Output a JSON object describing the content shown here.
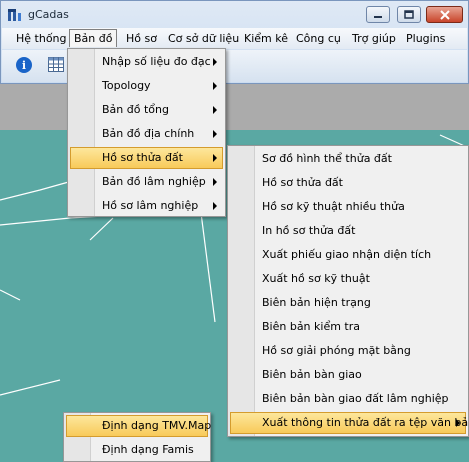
{
  "window": {
    "title": "gCadas"
  },
  "menubar": {
    "items": [
      "Hệ thống",
      "Bản đồ",
      "Hồ sơ",
      "Cơ sở dữ liệu",
      "Kiểm kê",
      "Công cụ",
      "Trợ giúp",
      "Plugins"
    ],
    "active": "Bản đồ"
  },
  "toolbar": {
    "info_icon": "i"
  },
  "menu_bando": {
    "items": [
      {
        "label": "Nhập số liệu đo đạc",
        "submenu": true
      },
      {
        "label": "Topology",
        "submenu": true
      },
      {
        "label": "Bản đồ tổng",
        "submenu": true
      },
      {
        "label": "Bản đồ địa chính",
        "submenu": true
      },
      {
        "label": "Hồ sơ thửa đất",
        "submenu": true,
        "highlighted": true
      },
      {
        "label": "Bản đồ lâm nghiệp",
        "submenu": true
      },
      {
        "label": "Hồ sơ lâm nghiệp",
        "submenu": true
      }
    ]
  },
  "menu_hoso": {
    "items": [
      {
        "label": "Sơ đồ hình thể thửa đất"
      },
      {
        "label": "Hồ sơ thửa đất"
      },
      {
        "label": "Hồ sơ kỹ thuật nhiều thửa"
      },
      {
        "label": "In hồ sơ thửa đất"
      },
      {
        "label": "Xuất phiếu giao nhận diện tích"
      },
      {
        "label": "Xuất hồ sơ kỹ thuật"
      },
      {
        "label": "Biên bản hiện trạng"
      },
      {
        "label": "Biên bản kiểm  tra"
      },
      {
        "label": "Hồ sơ giải phóng mặt bằng"
      },
      {
        "label": "Biên bản bàn giao"
      },
      {
        "label": "Biên bản bàn giao đất lâm nghiệp"
      },
      {
        "label": "Xuất thông tin thửa đất ra tệp văn bản",
        "submenu": true,
        "highlighted": true
      }
    ]
  },
  "menu_xuat": {
    "items": [
      {
        "label": "Định dạng TMV.Map",
        "highlighted": true
      },
      {
        "label": "Định dạng Famis"
      }
    ]
  },
  "colors": {
    "map_fill": "#5aa8a3",
    "map_lines": "#ffffff",
    "highlight": "#f8ca5a",
    "close_button": "#c9452b"
  }
}
